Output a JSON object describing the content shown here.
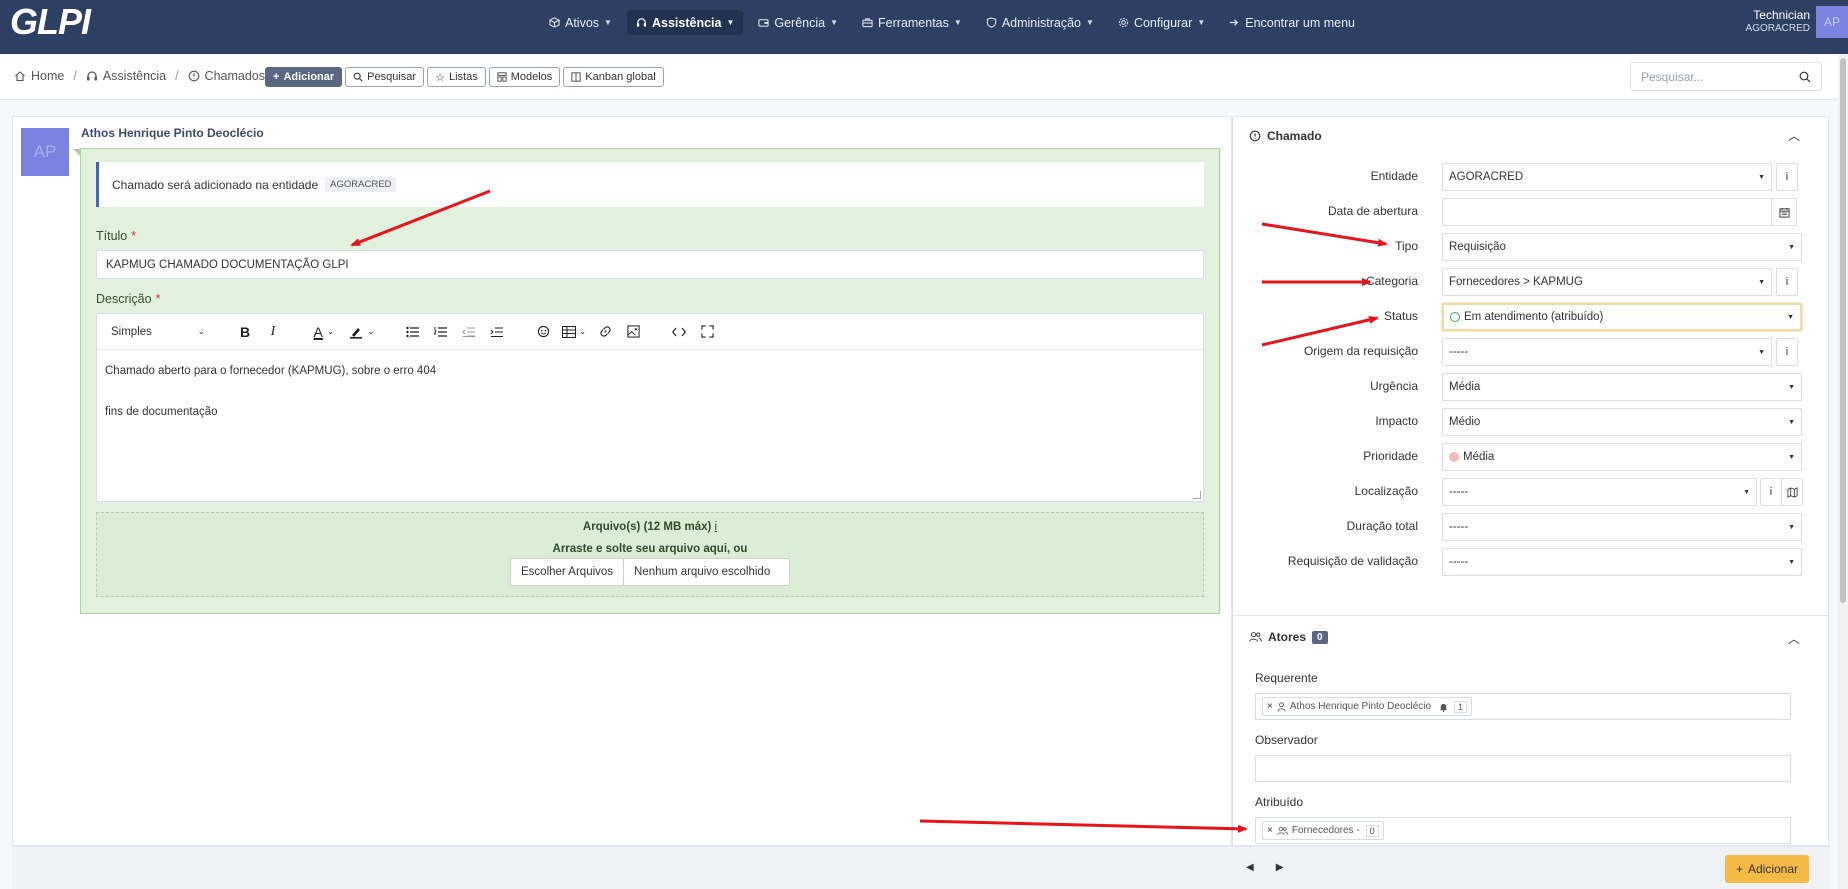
{
  "app": {
    "logo": "GLPI"
  },
  "nav": {
    "items": [
      {
        "label": "Ativos",
        "icon": "cube-icon",
        "active": false
      },
      {
        "label": "Assistência",
        "icon": "headset-icon",
        "active": true
      },
      {
        "label": "Gerência",
        "icon": "wallet-icon",
        "active": false
      },
      {
        "label": "Ferramentas",
        "icon": "briefcase-icon",
        "active": false
      },
      {
        "label": "Administração",
        "icon": "shield-icon",
        "active": false
      },
      {
        "label": "Configurar",
        "icon": "gear-icon",
        "active": false
      },
      {
        "label": "Encontrar um menu",
        "icon": "arrow-right-icon",
        "active": false
      }
    ]
  },
  "user": {
    "name": "Technician",
    "entity": "AGORACRED",
    "initials": "AP"
  },
  "breadcrumb": {
    "home": "Home",
    "section": "Assistência",
    "page": "Chamados"
  },
  "actions": {
    "add": "Adicionar",
    "search": "Pesquisar",
    "lists": "Listas",
    "models": "Modelos",
    "kanban": "Kanban global"
  },
  "global_search": {
    "placeholder": "Pesquisar..."
  },
  "ticket": {
    "author_initials": "AP",
    "author": "Athos Henrique Pinto Deoclécio",
    "notice_text": "Chamado será adicionado na entidade",
    "notice_entity": "AGORACRED",
    "title_label": "Título",
    "title_value": "KAPMUG CHAMADO DOCUMENTAÇÃO GLPI",
    "description_label": "Descrição",
    "format": "Simples",
    "description_line1": "Chamado aberto para o fornecedor (KAPMUG), sobre o erro 404",
    "description_line2": "fins de documentação",
    "files_title": "Arquivo(s) (12 MB máx)",
    "files_info": "i",
    "files_drop": "Arraste e solte seu arquivo aqui, ou",
    "files_choose": "Escolher Arquivos",
    "files_none": "Nenhum arquivo escolhido"
  },
  "panel": {
    "section_title": "Chamado",
    "fields": [
      {
        "label": "Entidade",
        "value": "AGORACRED"
      },
      {
        "label": "Data de abertura",
        "value": ""
      },
      {
        "label": "Tipo",
        "value": "Requisição"
      },
      {
        "label": "Categoria",
        "value": "Fornecedores > KAPMUG"
      },
      {
        "label": "Status",
        "value": "Em atendimento (atribuído)"
      },
      {
        "label": "Origem da requisição",
        "value": "-----"
      },
      {
        "label": "Urgência",
        "value": "Média"
      },
      {
        "label": "Impacto",
        "value": "Médio"
      },
      {
        "label": "Prioridade",
        "value": "Média"
      },
      {
        "label": "Localização",
        "value": "-----"
      },
      {
        "label": "Duração total",
        "value": "-----"
      },
      {
        "label": "Requisição de validação",
        "value": "-----"
      }
    ],
    "actors_title": "Atores",
    "actors_count": "0",
    "requester_label": "Requerente",
    "requester_name": "Athos Henrique Pinto Deoclécio",
    "requester_count": "1",
    "observer_label": "Observador",
    "assigned_label": "Atribuído",
    "assigned_name": "Fornecedores -",
    "assigned_count": "0"
  },
  "footer": {
    "add": "Adicionar"
  },
  "colors": {
    "navbar": "#2f3f64",
    "accent": "#f5b945",
    "bubble": "#e1f1de",
    "arrow": "#e8141a"
  }
}
